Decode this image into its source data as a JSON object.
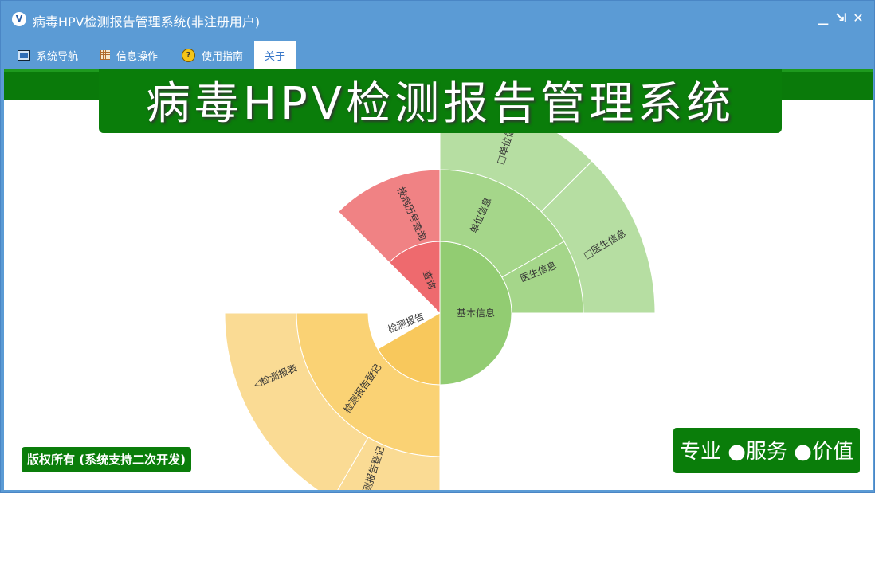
{
  "window": {
    "title": "病毒HPV检测报告管理系统(非注册用户)",
    "app_icon": "app-logo-icon"
  },
  "menu": {
    "items": [
      {
        "label": "系统导航",
        "icon": "nav-icon"
      },
      {
        "label": "信息操作",
        "icon": "grid-icon"
      },
      {
        "label": "使用指南",
        "icon": "help-icon"
      },
      {
        "label": "关于",
        "icon": ""
      }
    ]
  },
  "banner": {
    "title": "病毒HPV检测报告管理系统"
  },
  "sunburst": {
    "center": "基本信息",
    "segments": {
      "basic": "基本信息",
      "query": "查询",
      "report": "检测报告",
      "unit": "单位信息",
      "doctor": "医生信息",
      "query_child": "按病历号查询",
      "report_register": "检测报告登记",
      "unit_child": "□单位信息",
      "doctor_child": "□医生信息",
      "report_table": "◁检测报表",
      "report_register_child": "检测报告登记"
    },
    "colors": {
      "green_1": "#92cc72",
      "green_2": "#a5d68a",
      "green_3": "#b6dea2",
      "red_1": "#ee6a6e",
      "red_2": "#f08284",
      "yellow_1": "#f8c85c",
      "yellow_2": "#fad274",
      "yellow_3": "#fadb94"
    }
  },
  "footer": {
    "copyright": "版权所有 (系统支持二次开发)",
    "slogan": "专业 ●服务 ●价值"
  },
  "colors": {
    "title_bar": "#5b9bd5",
    "brand_green": "#0a7d0a"
  }
}
